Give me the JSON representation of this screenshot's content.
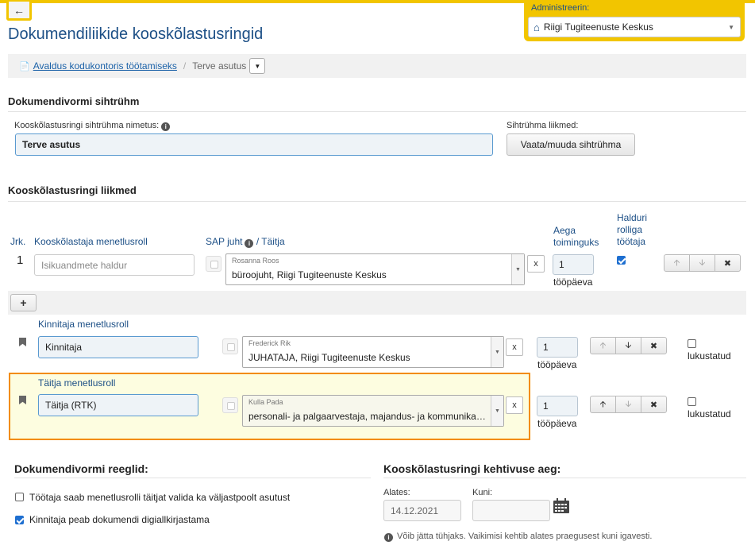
{
  "header": {
    "back_icon": "←",
    "page_title": "Dokumendiliikide kooskõlastusringid",
    "admin_label": "Administreerin:",
    "admin_value": "Riigi Tugiteenuste Keskus"
  },
  "breadcrumb": {
    "link": "Avaldus kodukontoris töötamiseks",
    "separator": "/",
    "current": "Terve asutus"
  },
  "target_group": {
    "section_title": "Dokumendivormi sihtrühm",
    "name_label": "Kooskõlastusringi sihtrühma nimetus:",
    "name_value": "Terve asutus",
    "members_label": "Sihtrühma liikmed:",
    "members_button": "Vaata/muuda sihtrühma"
  },
  "members": {
    "section_title": "Kooskõlastusringi liikmed",
    "col_jrk": "Jrk.",
    "col_role": "Kooskõlastaja menetlusroll",
    "col_sap": "SAP juht",
    "col_performer": "/ Täitja",
    "col_deadline_1": "Aega",
    "col_deadline_2": "toiminguks",
    "col_admin_1": "Halduri",
    "col_admin_2": "rolliga",
    "col_admin_3": "töötaja",
    "row1": {
      "jrk": "1",
      "role_placeholder": "Isikuandmete haldur",
      "person_name": "Rosanna Roos",
      "person_role": "büroojuht, Riigi Tugiteenuste Keskus",
      "x": "x",
      "days": "1",
      "unit": "tööpäeva"
    },
    "add_label": "+"
  },
  "approver": {
    "head": "Kinnitaja menetlusroll",
    "role_value": "Kinnitaja",
    "person_name": "Frederick Rik",
    "person_role": "JUHATAJA, Riigi Tugiteenuste Keskus",
    "x": "x",
    "days": "1",
    "unit": "tööpäeva",
    "locked_label": "lukustatud"
  },
  "performer": {
    "head": "Täitja menetlusroll",
    "role_value": "Täitja (RTK)",
    "person_name": "Kulla Pada",
    "person_role": "personali- ja palgaarvestaja, majandus- ja kommunikatsiooni",
    "x": "x",
    "days": "1",
    "unit": "tööpäeva",
    "locked_label": "lukustatud"
  },
  "rules": {
    "section_title": "Dokumendivormi reeglid:",
    "rule1": "Töötaja saab menetlusrolli täitjat valida ka väljastpoolt asutust",
    "rule1_checked": false,
    "rule2": "Kinnitaja peab dokumendi digiallkirjastama",
    "rule2_checked": true
  },
  "validity": {
    "section_title": "Kooskõlastusringi kehtivuse aeg:",
    "from_label": "Alates:",
    "from_value": "14.12.2021",
    "to_label": "Kuni:",
    "to_value": "",
    "hint": "Võib jätta tühjaks. Vaikimisi kehtib alates praegusest kuni igavesti."
  },
  "colors": {
    "accent_yellow": "#f2c500",
    "title_blue": "#1c4f86",
    "highlight_border": "#f28c00"
  }
}
